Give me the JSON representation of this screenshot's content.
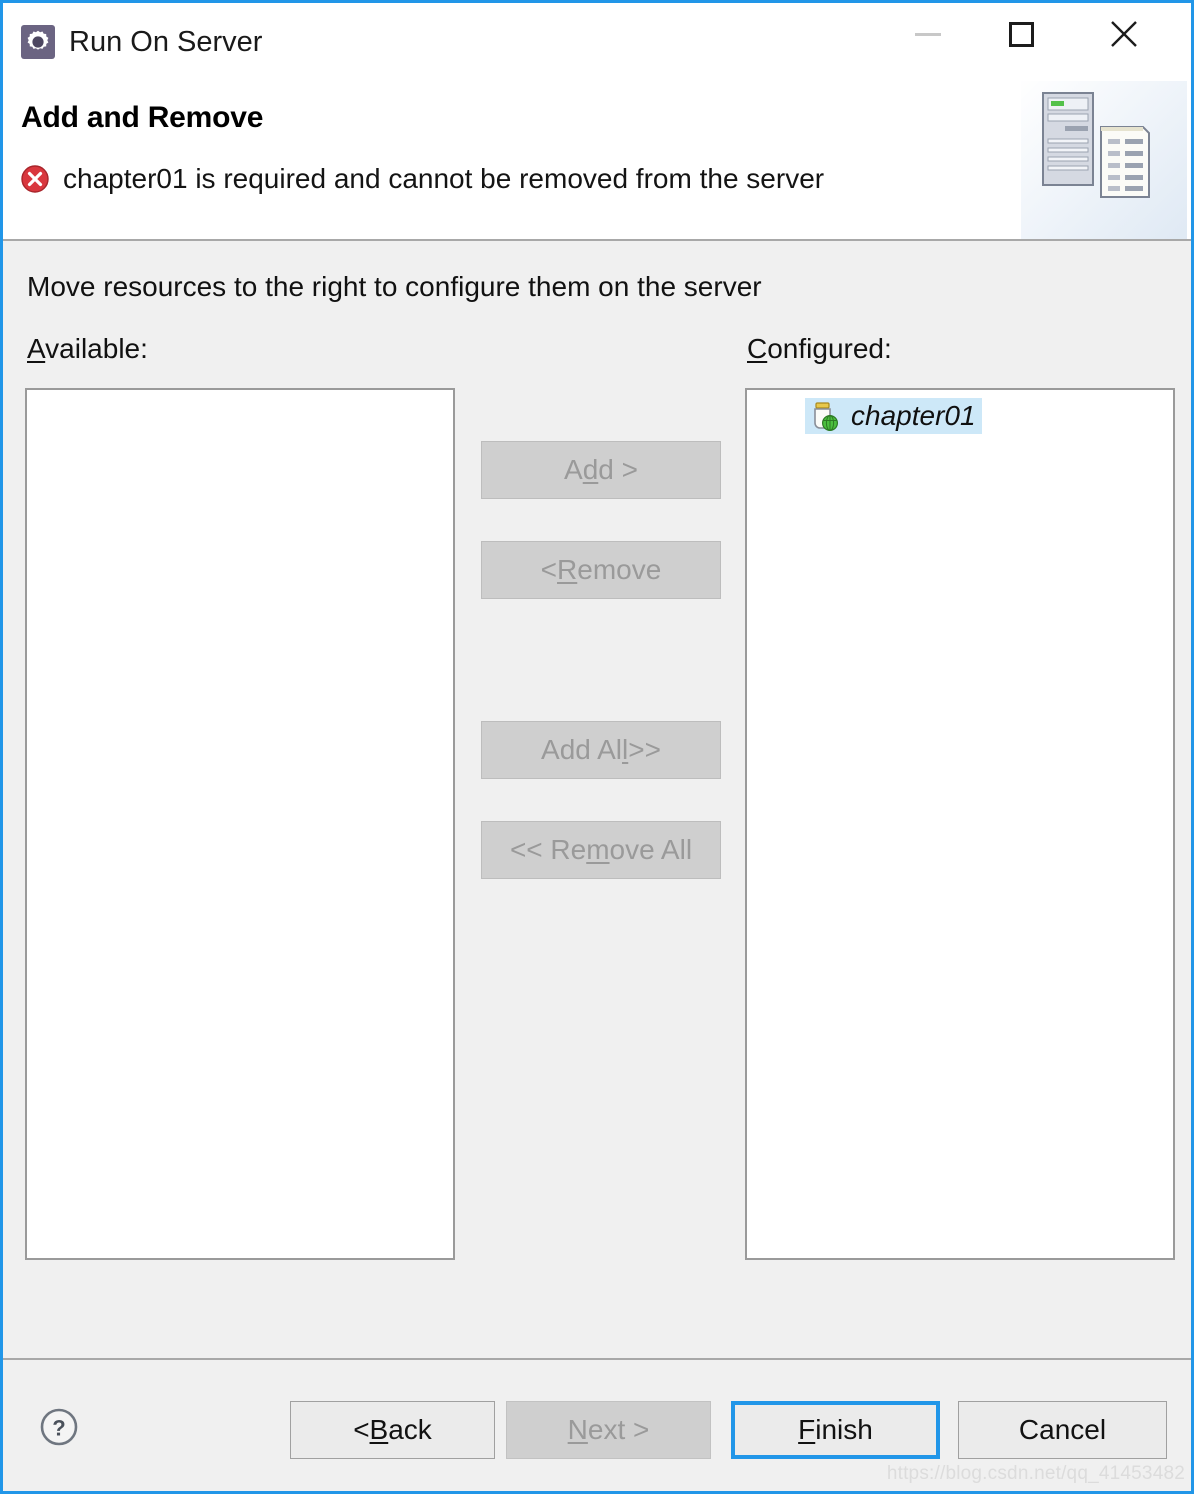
{
  "window": {
    "title": "Run On Server",
    "app_icon": "gear-icon",
    "controls": {
      "minimize": "minimize-icon",
      "maximize": "maximize-icon",
      "close": "close-icon"
    }
  },
  "header": {
    "title": "Add and Remove",
    "message": "chapter01 is required and cannot be removed from the server",
    "message_icon": "error-icon",
    "banner_icon": "server-and-document-icon"
  },
  "body": {
    "instruction": "Move resources to the right to configure them on the server",
    "available_label": "Available:",
    "available_mnemonic": "A",
    "configured_label": "Configured:",
    "configured_mnemonic": "C",
    "available_items": [],
    "configured_items": [
      {
        "label": "chapter01",
        "icon": "web-project-icon",
        "selected": true
      }
    ]
  },
  "transfer_buttons": {
    "add": {
      "pre": "A",
      "mnemonic": "d",
      "post": "d >",
      "enabled": false
    },
    "remove": {
      "pre": "< ",
      "mnemonic": "R",
      "post": "emove",
      "enabled": false
    },
    "add_all": {
      "pre": "Add Al",
      "mnemonic": "l",
      "post": " >>",
      "enabled": false
    },
    "remove_all": {
      "pre": "<< Re",
      "mnemonic": "m",
      "post": "ove All",
      "enabled": false
    }
  },
  "footer": {
    "help": "help-icon",
    "back": {
      "pre": "< ",
      "mnemonic": "B",
      "post": "ack",
      "enabled": true
    },
    "next": {
      "pre": "",
      "mnemonic": "N",
      "post": "ext >",
      "enabled": false
    },
    "finish": {
      "pre": "",
      "mnemonic": "F",
      "post": "inish",
      "enabled": true,
      "default": true
    },
    "cancel": {
      "pre": "Cancel",
      "mnemonic": "",
      "post": "",
      "enabled": true
    }
  },
  "watermark": "https://blog.csdn.net/qq_41453482",
  "colors": {
    "dialog_border": "#2196e8",
    "body_bg": "#f0f0f0",
    "header_bg": "#ffffff",
    "selection_bg": "#cde8f8",
    "error_red": "#d9373e",
    "disabled_text": "#9a9a9a"
  }
}
